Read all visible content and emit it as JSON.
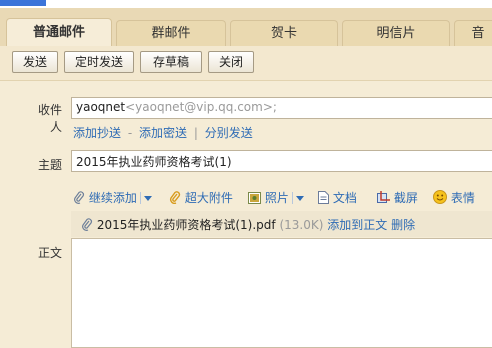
{
  "tabs": [
    {
      "label": "普通邮件",
      "active": true
    },
    {
      "label": "群邮件",
      "active": false
    },
    {
      "label": "贺卡",
      "active": false
    },
    {
      "label": "明信片",
      "active": false
    },
    {
      "label": "音",
      "active": false
    }
  ],
  "toolbar": {
    "send": "发送",
    "scheduled_send": "定时发送",
    "save_draft": "存草稿",
    "close": "关闭"
  },
  "recipient": {
    "label": "收件人",
    "name": "yaoqnet",
    "address": "<yaoqnet@vip.qq.com>;"
  },
  "recipient_links": {
    "cc": "添加抄送",
    "dash": "-",
    "bcc": "添加密送",
    "bar": "|",
    "separate": "分别发送"
  },
  "subject": {
    "label": "主题",
    "value": "2015年执业药师资格考试(1)"
  },
  "attach_toolbar": {
    "continue_add": "继续添加",
    "large_attach": "超大附件",
    "photo": "照片",
    "document": "文档",
    "screenshot": "截屏",
    "emoji": "表情"
  },
  "attachment": {
    "filename": "2015年执业药师资格考试(1).pdf",
    "size": "(13.0K)",
    "add_to_body": "添加到正文",
    "delete": "删除"
  },
  "body": {
    "label": "正文"
  },
  "colors": {
    "link": "#2f6cb5",
    "background": "#f5ecd6",
    "tabbar": "#e9d9b5"
  }
}
